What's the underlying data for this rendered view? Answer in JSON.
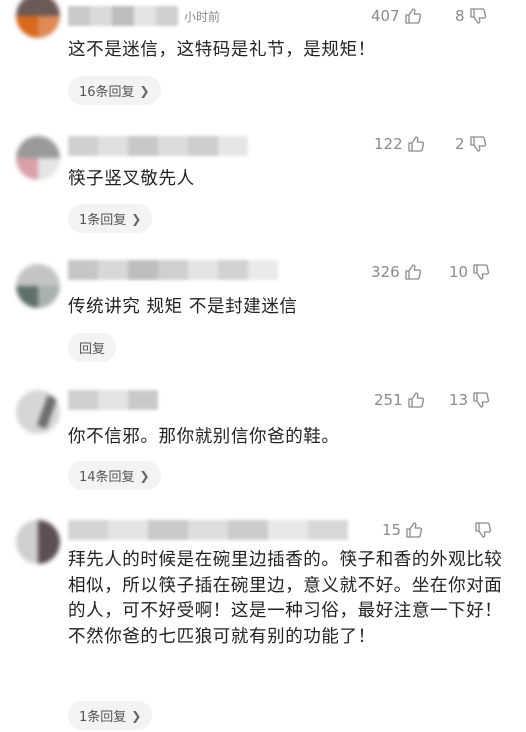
{
  "colors": {
    "text": "#222222",
    "meta": "#8a8a8a",
    "pill": "#f3f3f3"
  },
  "icons": {
    "like": "thumb-up-icon",
    "dislike": "thumb-down-icon",
    "more": "chevron-right-icon"
  },
  "comments": [
    {
      "time": "小时前",
      "likes": "407",
      "dislikes": "8",
      "text": "这不是迷信，这特码是礼节，是规矩！",
      "replies": "16条回复"
    },
    {
      "likes": "122",
      "dislikes": "2",
      "text": "筷子竖叉敬先人",
      "replies": "1条回复"
    },
    {
      "likes": "326",
      "dislikes": "10",
      "text": "传统讲究 规矩 不是封建迷信",
      "replies": "回复"
    },
    {
      "likes": "251",
      "dislikes": "13",
      "text": "你不信邪。那你就别信你爸的鞋。",
      "replies": "14条回复"
    },
    {
      "likes": "15",
      "dislikes": "",
      "text": "拜先人的时候是在碗里边插香的。筷子和香的外观比较相似，所以筷子插在碗里边，意义就不好。坐在你对面的人，可不好受啊！这是一种习俗，最好注意一下好！不然你爸的七匹狼可就有别的功能了！",
      "replies": "1条回复"
    }
  ]
}
